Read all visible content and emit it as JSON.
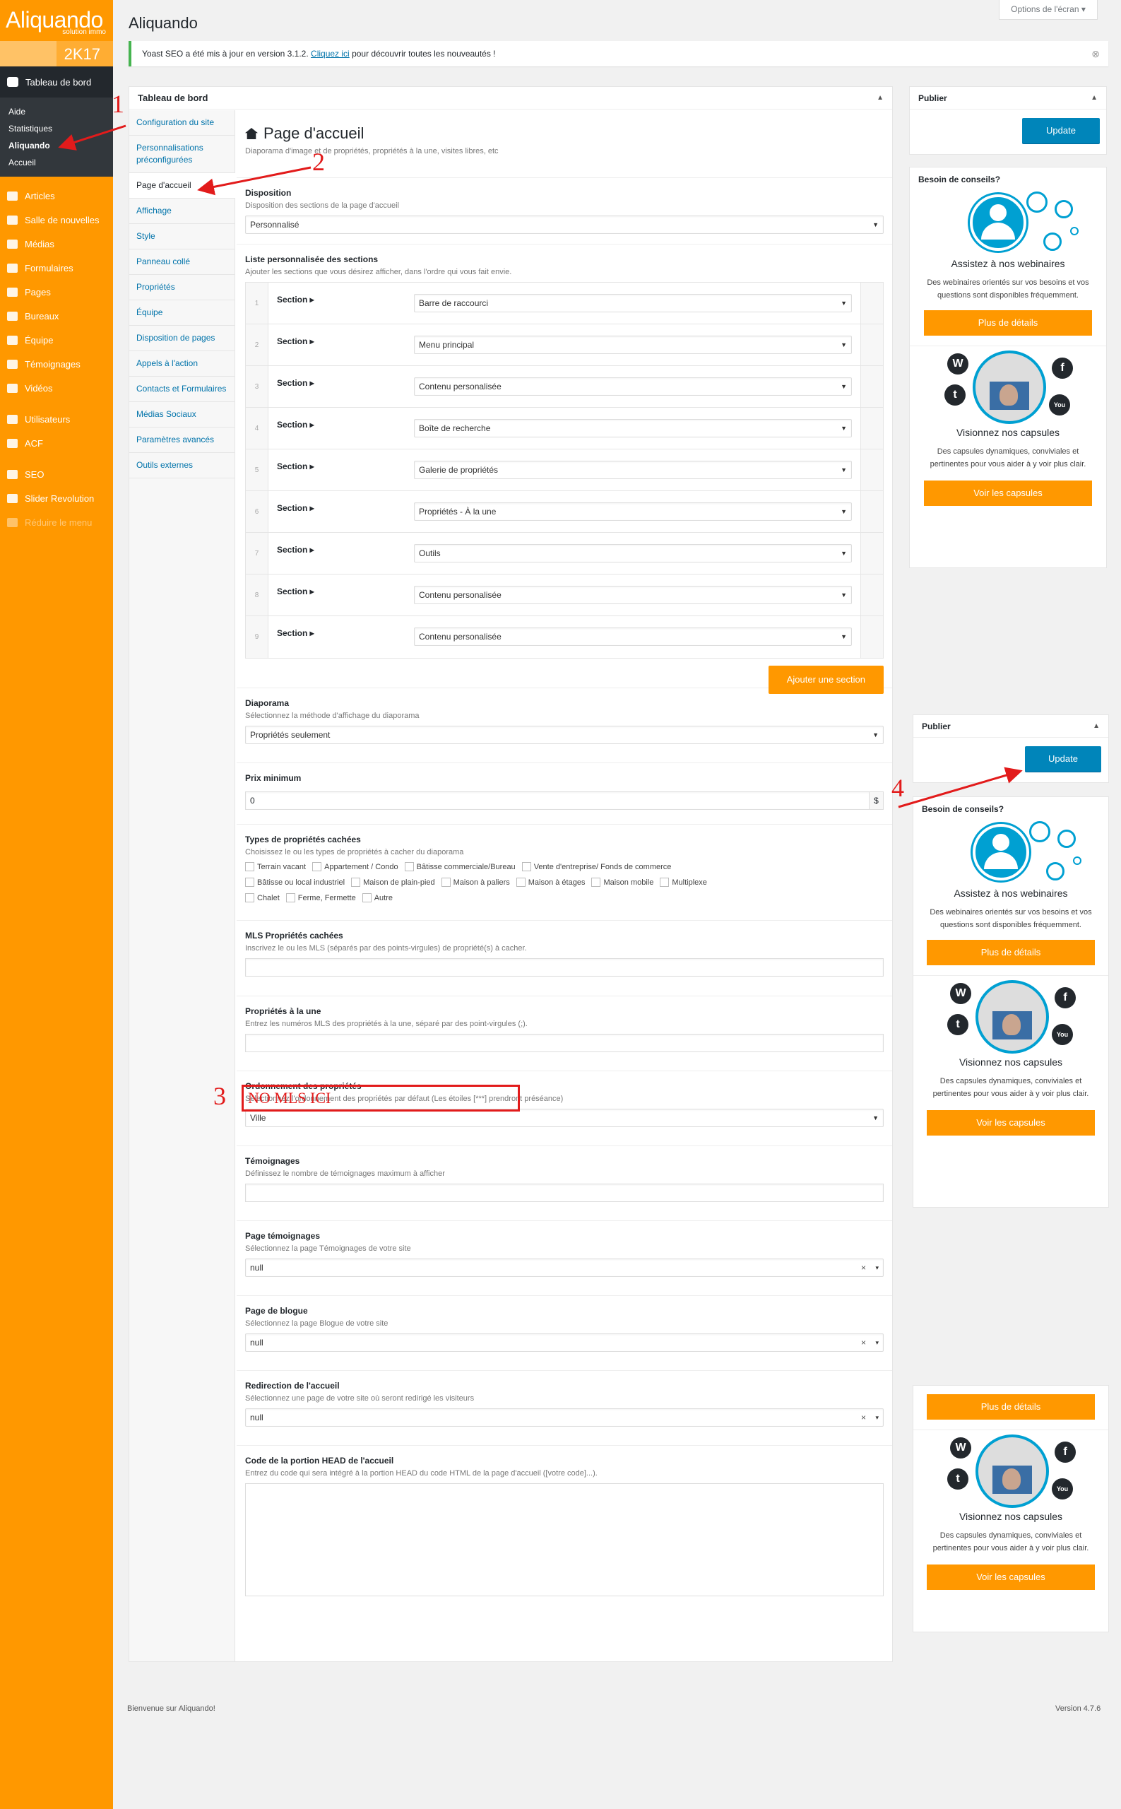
{
  "menu": {
    "brand": "Aliquando",
    "brand_tag": "solution immo",
    "version_badge": "2K17",
    "current": "Tableau de bord",
    "submenu": [
      "Aide",
      "Statistiques",
      "Aliquando",
      "Accueil"
    ],
    "items_a": [
      "Articles",
      "Salle de nouvelles",
      "Médias",
      "Formulaires",
      "Pages",
      "Bureaux",
      "Équipe",
      "Témoignages",
      "Vidéos"
    ],
    "items_b": [
      "Utilisateurs",
      "ACF"
    ],
    "items_c": [
      "SEO",
      "Slider Revolution",
      "Réduire le menu"
    ]
  },
  "page": {
    "title": "Aliquando",
    "screen_options": "Options de l'écran ▾",
    "notice_text": "Yoast SEO a été mis à jour en version 3.1.2.",
    "notice_link": "Cliquez ici",
    "notice_after": "pour découvrir toutes les nouveautés !",
    "notice_close": "⊗"
  },
  "panel": {
    "header": "Tableau de bord",
    "tabs": [
      "Configuration du site",
      "Personnalisations préconfigurées",
      "Page d'accueil",
      "Affichage",
      "Style",
      "Panneau collé",
      "Propriétés",
      "Équipe",
      "Disposition de pages",
      "Appels à l'action",
      "Contacts et Formulaires",
      "Médias Sociaux",
      "Paramètres avancés",
      "Outils externes"
    ],
    "page_title": "Page d'accueil",
    "page_desc": "Diaporama d'image et de propriétés, propriétés à la une, visites libres, etc",
    "disposition": {
      "label": "Disposition",
      "desc": "Disposition des sections de la page d'accueil",
      "value": "Personnalisé"
    },
    "sections": {
      "label": "Liste personnalisée des sections",
      "desc": "Ajouter les sections que vous désirez afficher, dans l'ordre qui vous fait envie.",
      "row_label": "Section ▸",
      "rows": [
        "Barre de raccourci",
        "Menu principal",
        "Contenu personalisée",
        "Boîte de recherche",
        "Galerie de propriétés",
        "Propriétés - À la une",
        "Outils",
        "Contenu personalisée",
        "Contenu personalisée"
      ],
      "nums": [
        "1",
        "2",
        "3",
        "4",
        "5",
        "6",
        "7",
        "8",
        "9"
      ],
      "add_button": "Ajouter une section"
    },
    "diaporama": {
      "label": "Diaporama",
      "desc": "Sélectionnez la méthode d'affichage du diaporama",
      "value": "Propriétés seulement"
    },
    "prix": {
      "label": "Prix minimum",
      "value": "0",
      "suffix": "$"
    },
    "types": {
      "label": "Types de propriétés cachées",
      "desc": "Choisissez le ou les types de propriétés à cacher du diaporama",
      "row1": [
        "Terrain vacant",
        "Appartement / Condo",
        "Bâtisse commerciale/Bureau",
        "Vente d'entreprise/ Fonds de commerce"
      ],
      "row2": [
        "Bâtisse ou local industriel",
        "Maison de plain-pied",
        "Maison à paliers",
        "Maison à étages",
        "Maison mobile",
        "Multiplexe"
      ],
      "row3": [
        "Chalet",
        "Ferme, Fermette",
        "Autre"
      ]
    },
    "mls": {
      "label": "MLS Propriétés cachées",
      "desc": "Inscrivez le ou les MLS (séparés par des points-virgules) de propriété(s) à cacher."
    },
    "une": {
      "label": "Propriétés à la une",
      "desc": "Entrez les numéros MLS des propriétés à la une, séparé par des point-virgules (;)."
    },
    "ordre": {
      "label": "Ordonnement des propriétés",
      "desc": "Sélectionnez l'ordonnement des propriétés par défaut (Les étoiles [***] prendront préséance)",
      "value": "Ville"
    },
    "temoignages": {
      "label": "Témoignages",
      "desc": "Définissez le nombre de témoignages maximum à afficher"
    },
    "page_tem": {
      "label": "Page témoignages",
      "desc": "Sélectionnez la page Témoignages de votre site",
      "value": "null"
    },
    "page_blog": {
      "label": "Page de blogue",
      "desc": "Sélectionnez la page Blogue de votre site",
      "value": "null"
    },
    "redirect": {
      "label": "Redirection de l'accueil",
      "desc": "Sélectionnez une page de votre site où seront redirigé les visiteurs",
      "value": "null"
    },
    "head": {
      "label": "Code de la portion HEAD de l'accueil",
      "desc": "Entrez du code qui sera intégré à la portion HEAD du code HTML de la page d'accueil ([votre code]...)."
    }
  },
  "sidebar": {
    "publish": "Publier",
    "update": "Update",
    "help_title": "Besoin de conseils?",
    "webinar_title": "Assistez à nos webinaires",
    "webinar_desc": "Des webinaires orientés sur vos besoins et vos questions sont disponibles fréquemment.",
    "webinar_btn": "Plus de détails",
    "capsule_title": "Visionnez nos capsules",
    "capsule_desc": "Des capsules dynamiques, conviviales et pertinentes pour vous aider à y voir plus clair.",
    "capsule_btn": "Voir les capsules",
    "icons": {
      "wp": "W",
      "fb": "f",
      "tw": "t",
      "yt": "You"
    }
  },
  "annotations": {
    "n1": "1",
    "n2": "2",
    "n3": "3",
    "n4": "4",
    "mls_note": "NO MLS ICI"
  },
  "footer": {
    "left": "Bienvenue sur Aliquando!",
    "right": "Version 4.7.6"
  }
}
